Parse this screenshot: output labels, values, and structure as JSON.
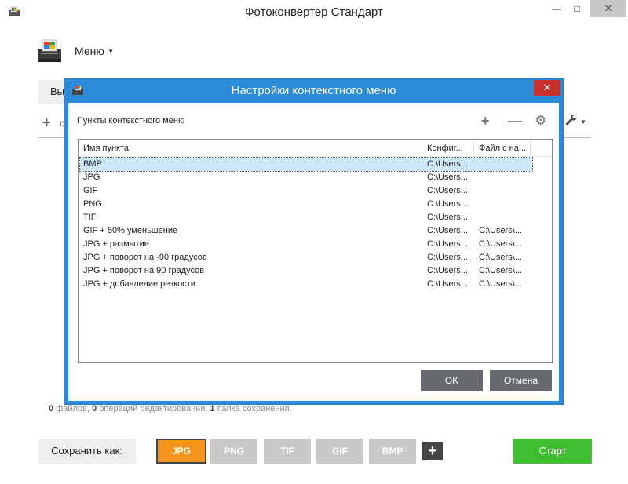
{
  "window": {
    "title": "Фотоконвертер Стандарт",
    "minimize_glyph": "—",
    "maximize_glyph": "□",
    "close_glyph": "✕"
  },
  "menu": {
    "label": "Меню",
    "caret": "▾"
  },
  "behind": {
    "tab_fragment": "Вы",
    "plus_glyph": "+",
    "plus_text_fragment": "с"
  },
  "status": {
    "files_count": "0",
    "files_label": "файлов,",
    "ops_count": "0",
    "ops_label": "операций редактирования,",
    "folders_count": "1",
    "folders_label": "папка сохранения."
  },
  "bottom": {
    "save_as_label": "Сохранить как:",
    "formats": [
      "JPG",
      "PNG",
      "TIF",
      "GIF",
      "BMP"
    ],
    "selected_format": "JPG",
    "add_format_glyph": "+",
    "start_label": "Старт"
  },
  "dialog": {
    "title": "Настройки контекстного меню",
    "close_glyph": "✕",
    "caption": "Пункты контекстного меню",
    "tools": {
      "add_glyph": "+",
      "remove_glyph": "—",
      "settings_glyph": "⚙"
    },
    "columns": [
      "Имя пункта",
      "Конфиг...",
      "Файл с на..."
    ],
    "rows": [
      {
        "name": "BMP",
        "config": "C:\\Users...",
        "file": ""
      },
      {
        "name": "JPG",
        "config": "C:\\Users...",
        "file": ""
      },
      {
        "name": "GIF",
        "config": "C:\\Users...",
        "file": ""
      },
      {
        "name": "PNG",
        "config": "C:\\Users...",
        "file": ""
      },
      {
        "name": "TIF",
        "config": "C:\\Users...",
        "file": ""
      },
      {
        "name": "GIF + 50% уменьшение",
        "config": "C:\\Users...",
        "file": "C:\\Users\\..."
      },
      {
        "name": "JPG + размытие",
        "config": "C:\\Users...",
        "file": "C:\\Users\\..."
      },
      {
        "name": "JPG + поворот на -90 градусов",
        "config": "C:\\Users...",
        "file": "C:\\Users\\..."
      },
      {
        "name": "JPG + поворот на 90 градусов",
        "config": "C:\\Users...",
        "file": "C:\\Users\\..."
      },
      {
        "name": "JPG + добавление резкости",
        "config": "C:\\Users...",
        "file": "C:\\Users\\..."
      }
    ],
    "selected_row": 0,
    "ok_label": "OK",
    "cancel_label": "Отмена"
  },
  "colors": {
    "dialog_frame": "#2c8bd8",
    "selected_format": "#f7941d",
    "start_button": "#3fbf30",
    "dialog_close": "#c8312b",
    "dialog_button": "#666a6e"
  }
}
